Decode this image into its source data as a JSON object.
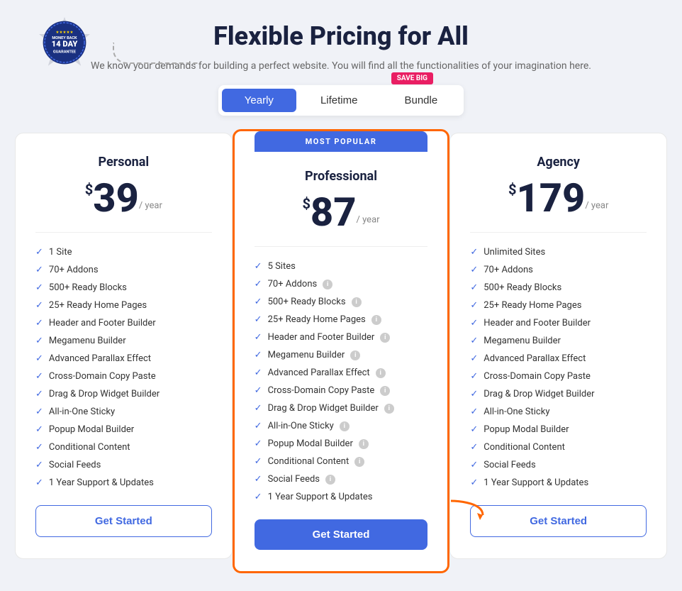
{
  "header": {
    "title": "Flexible Pricing for All",
    "subtitle": "We know your demands for building a perfect website. You will find all the functionalities of your imagination here.",
    "save_big_label": "SAVE BIG"
  },
  "toggle": {
    "yearly_label": "Yearly",
    "lifetime_label": "Lifetime",
    "bundle_label": "Bundle",
    "active": "yearly"
  },
  "most_popular_label": "MOST POPULAR",
  "plans": [
    {
      "id": "personal",
      "name": "Personal",
      "currency": "$",
      "price": "39",
      "period": "/ year",
      "featured": false,
      "features": [
        {
          "text": "1 Site",
          "info": false
        },
        {
          "text": "70+ Addons",
          "info": false
        },
        {
          "text": "500+ Ready Blocks",
          "info": false
        },
        {
          "text": "25+ Ready Home Pages",
          "info": false
        },
        {
          "text": "Header and Footer Builder",
          "info": false
        },
        {
          "text": "Megamenu Builder",
          "info": false
        },
        {
          "text": "Advanced Parallax Effect",
          "info": false
        },
        {
          "text": "Cross-Domain Copy Paste",
          "info": false
        },
        {
          "text": "Drag & Drop Widget Builder",
          "info": false
        },
        {
          "text": "All-in-One Sticky",
          "info": false
        },
        {
          "text": "Popup Modal Builder",
          "info": false
        },
        {
          "text": "Conditional Content",
          "info": false
        },
        {
          "text": "Social Feeds",
          "info": false
        },
        {
          "text": "1 Year Support & Updates",
          "info": false
        }
      ],
      "cta_label": "Get Started"
    },
    {
      "id": "professional",
      "name": "Professional",
      "currency": "$",
      "price": "87",
      "period": "/ year",
      "featured": true,
      "features": [
        {
          "text": "5 Sites",
          "info": false
        },
        {
          "text": "70+ Addons",
          "info": true
        },
        {
          "text": "500+ Ready Blocks",
          "info": true
        },
        {
          "text": "25+ Ready Home Pages",
          "info": true
        },
        {
          "text": "Header and Footer Builder",
          "info": true
        },
        {
          "text": "Megamenu Builder",
          "info": true
        },
        {
          "text": "Advanced Parallax Effect",
          "info": true
        },
        {
          "text": "Cross-Domain Copy Paste",
          "info": true
        },
        {
          "text": "Drag & Drop Widget Builder",
          "info": true
        },
        {
          "text": "All-in-One Sticky",
          "info": true
        },
        {
          "text": "Popup Modal Builder",
          "info": true
        },
        {
          "text": "Conditional Content",
          "info": true
        },
        {
          "text": "Social Feeds",
          "info": true
        },
        {
          "text": "1 Year Support & Updates",
          "info": false
        }
      ],
      "cta_label": "Get Started"
    },
    {
      "id": "agency",
      "name": "Agency",
      "currency": "$",
      "price": "179",
      "period": "/ year",
      "featured": false,
      "features": [
        {
          "text": "Unlimited Sites",
          "info": false
        },
        {
          "text": "70+ Addons",
          "info": false
        },
        {
          "text": "500+ Ready Blocks",
          "info": false
        },
        {
          "text": "25+ Ready Home Pages",
          "info": false
        },
        {
          "text": "Header and Footer Builder",
          "info": false
        },
        {
          "text": "Megamenu Builder",
          "info": false
        },
        {
          "text": "Advanced Parallax Effect",
          "info": false
        },
        {
          "text": "Cross-Domain Copy Paste",
          "info": false
        },
        {
          "text": "Drag & Drop Widget Builder",
          "info": false
        },
        {
          "text": "All-in-One Sticky",
          "info": false
        },
        {
          "text": "Popup Modal Builder",
          "info": false
        },
        {
          "text": "Conditional Content",
          "info": false
        },
        {
          "text": "Social Feeds",
          "info": false
        },
        {
          "text": "1 Year Support & Updates",
          "info": false
        }
      ],
      "cta_label": "Get Started"
    }
  ],
  "colors": {
    "primary": "#4169e1",
    "accent": "#ff6600",
    "badge_bg": "#1a2240"
  }
}
